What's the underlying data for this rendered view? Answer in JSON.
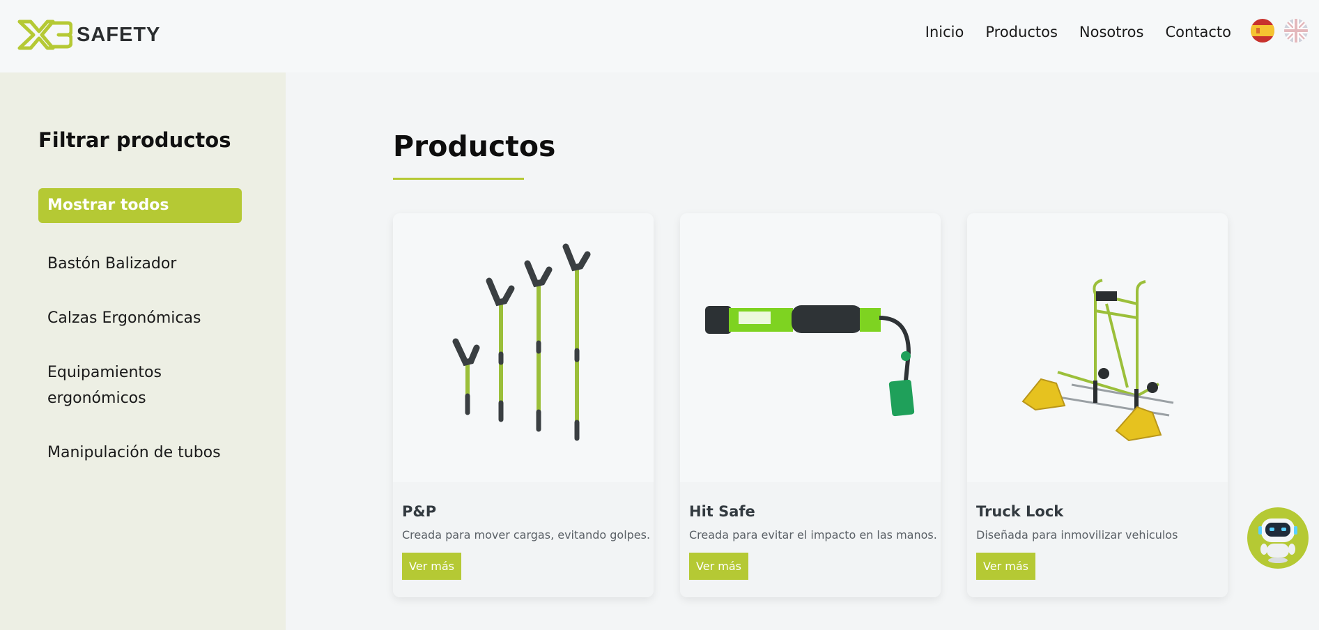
{
  "brand": {
    "logo_mark": "X3",
    "logo_text": "SAFETY",
    "accent": "#b5c934"
  },
  "nav": {
    "items": [
      {
        "label": "Inicio"
      },
      {
        "label": "Productos"
      },
      {
        "label": "Nosotros"
      },
      {
        "label": "Contacto"
      }
    ],
    "languages": [
      "es-flag-icon",
      "uk-flag-icon"
    ]
  },
  "sidebar": {
    "title": "Filtrar productos",
    "filters": [
      {
        "label": "Mostrar todos",
        "active": true
      },
      {
        "label": "Bastón Balizador",
        "active": false
      },
      {
        "label": "Calzas Ergonómicas",
        "active": false
      },
      {
        "label": "Equipamientos ergonómicos",
        "active": false
      },
      {
        "label": "Manipulación de tubos",
        "active": false
      }
    ]
  },
  "main": {
    "title": "Productos",
    "products": [
      {
        "name": "P&P",
        "description": "Creada para mover cargas, evitando golpes.",
        "button": "Ver más",
        "image": "pole-set-icon"
      },
      {
        "name": "Hit Safe",
        "description": "Creada para evitar el impacto en las manos.",
        "button": "Ver más",
        "image": "hit-safe-tool-icon"
      },
      {
        "name": "Truck Lock",
        "description": "Diseñada para inmovilizar vehiculos",
        "button": "Ver más",
        "image": "truck-lock-cart-icon"
      }
    ]
  },
  "chatbot": {
    "icon": "robot-icon"
  }
}
